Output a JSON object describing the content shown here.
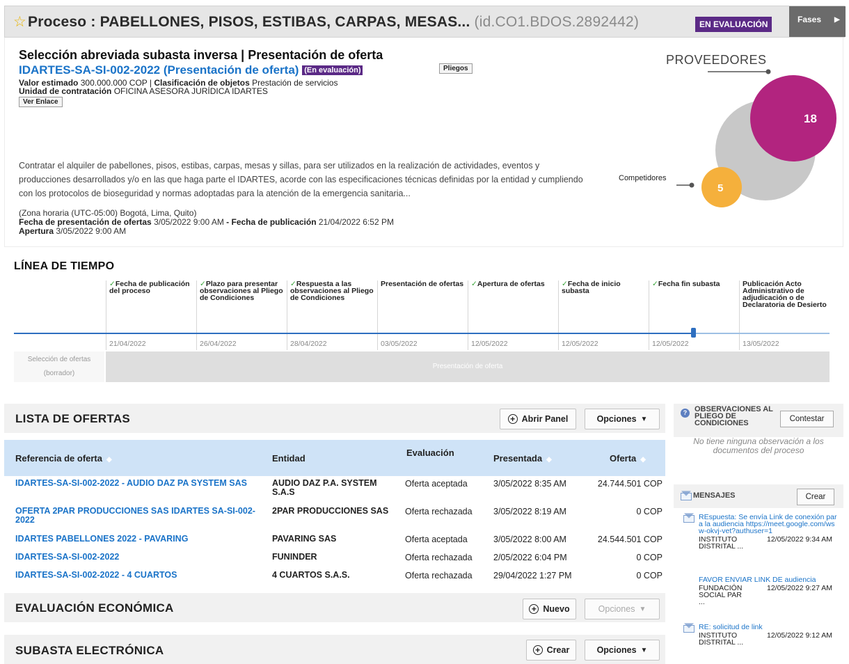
{
  "header": {
    "title": "Proceso : PABELLONES, PISOS, ESTIBAS, CARPAS, MESAS...",
    "id_text": "(id.CO1.BDOS.2892442)",
    "status": "EN EVALUACIÓN",
    "fases": "Fases"
  },
  "summary": {
    "heading": "Selección abreviada subasta inversa | Presentación de oferta",
    "reference": "IDARTES-SA-SI-002-2022 (Presentación de oferta)",
    "ref_status": "(En evaluación)",
    "pliegos_button": "Pliegos",
    "valor_label": "Valor estimado",
    "valor_value": "300.000.000 COP",
    "clasif_label": "Clasificación de objetos",
    "clasif_value": "Prestación de servicios",
    "unidad_label": "Unidad de contratación",
    "unidad_value": "OFICINA ASESORA JURÍDICA IDARTES",
    "ver_enlace_button": "Ver Enlace",
    "description": "Contratar el alquiler de pabellones, pisos, estibas, carpas, mesas y sillas, para ser utilizados en la realización de actividades, eventos y producciones desarrollados y/o en las que haga parte el IDARTES, acorde con las especificaciones técnicas definidas por la entidad y cumpliendo con los protocolos de bioseguridad y normas adoptadas para la atención de la emergencia sanitaria...",
    "timezone": "(Zona horaria (UTC-05:00) Bogotá, Lima, Quito)",
    "fecha_pres_label": "Fecha de presentación de ofertas",
    "fecha_pres_value": "3/05/2022 9:00 AM",
    "dash": " - ",
    "fecha_pub_label": "Fecha de publicación",
    "fecha_pub_value": "21/04/2022 6:52 PM",
    "apertura_label": "Apertura",
    "apertura_value": "3/05/2022 9:00 AM"
  },
  "providers": {
    "title": "PROVEEDORES",
    "competitors_label": "Competidores",
    "providers_count": "18",
    "competitors_count": "5",
    "providers_color": "#b2247f",
    "competitors_color": "#f5b03c"
  },
  "timeline": {
    "title": "LÍNEA DE TIEMPO",
    "steps": [
      {
        "label": "Fecha de publicación del proceso",
        "date": "21/04/2022",
        "checked": true
      },
      {
        "label": "Plazo para presentar observaciones al Pliego de Condiciones",
        "date": "26/04/2022",
        "checked": true
      },
      {
        "label": "Respuesta a las observaciones al Pliego de Condiciones",
        "date": "28/04/2022",
        "checked": true
      },
      {
        "label": "Presentación de ofertas",
        "date": "03/05/2022",
        "checked": false
      },
      {
        "label": "Apertura de ofertas",
        "date": "12/05/2022",
        "checked": true
      },
      {
        "label": "Fecha de inicio subasta",
        "date": "12/05/2022",
        "checked": true
      },
      {
        "label": "Fecha fin subasta",
        "date": "12/05/2022",
        "checked": true
      },
      {
        "label": "Publicación Acto Administrativo de adjudicación o de Declaratoria de Desierto",
        "date": "13/05/2022",
        "checked": false
      }
    ],
    "phase_a": "Selección de ofertas (borrador)",
    "phase_b": "Presentación de oferta"
  },
  "offers": {
    "title": "LISTA DE OFERTAS",
    "open_panel": "Abrir Panel",
    "options": "Opciones",
    "columns": [
      "Referencia de oferta",
      "Entidad",
      "Evaluación",
      "Presentada",
      "Oferta"
    ],
    "rows": [
      {
        "ref": "IDARTES-SA-SI-002-2022 - AUDIO DAZ PA SYSTEM SAS",
        "entity": "AUDIO DAZ P.A. SYSTEM S.A.S",
        "eval": "Oferta aceptada",
        "date": "3/05/2022 8:35 AM",
        "offer": "24.744.501 COP"
      },
      {
        "ref": "OFERTA 2PAR PRODUCCIONES SAS IDARTES SA-SI-002-2022",
        "entity": "2PAR PRODUCCIONES SAS",
        "eval": "Oferta rechazada",
        "date": "3/05/2022 8:19 AM",
        "offer": "0 COP"
      },
      {
        "ref": "IDARTES PABELLONES 2022 - PAVARING",
        "entity": "PAVARING SAS",
        "eval": "Oferta aceptada",
        "date": "3/05/2022 8:00 AM",
        "offer": "24.544.501 COP"
      },
      {
        "ref": "IDARTES-SA-SI-002-2022",
        "entity": "FUNINDER",
        "eval": "Oferta rechazada",
        "date": "2/05/2022 6:04 PM",
        "offer": "0 COP"
      },
      {
        "ref": "IDARTES-SA-SI-002-2022 - 4 CUARTOS",
        "entity": "4 CUARTOS S.A.S.",
        "eval": "Oferta rechazada",
        "date": "29/04/2022 1:27 PM",
        "offer": "0 COP"
      }
    ]
  },
  "economic": {
    "title": "EVALUACIÓN ECONÓMICA",
    "new_button": "Nuevo",
    "options": "Opciones"
  },
  "auction": {
    "title": "SUBASTA ELECTRÓNICA",
    "create_button": "Crear",
    "options": "Opciones"
  },
  "observations": {
    "title": "OBSERVACIONES AL PLIEGO DE CONDICIONES",
    "reply_button": "Contestar",
    "empty": "No tiene ninguna observación a los documentos del proceso"
  },
  "messages": {
    "title": "MENSAJES",
    "create_button": "Crear",
    "items": [
      {
        "subject": "REspuesta: Se envía Link de conexión para la audiencia https://meet.google.com/wsw-okvj-vet?authuser=1",
        "from": "INSTITUTO DISTRITAL ...",
        "date": "12/05/2022 9:34 AM"
      },
      {
        "subject": "FAVOR ENVIAR LINK DE audiencia",
        "from": "FUNDACIÓN SOCIAL PAR ...",
        "date": "12/05/2022 9:27 AM"
      },
      {
        "subject": "RE: solicitud de link",
        "from": "INSTITUTO DISTRITAL ...",
        "date": "12/05/2022 9:12 AM"
      }
    ]
  }
}
